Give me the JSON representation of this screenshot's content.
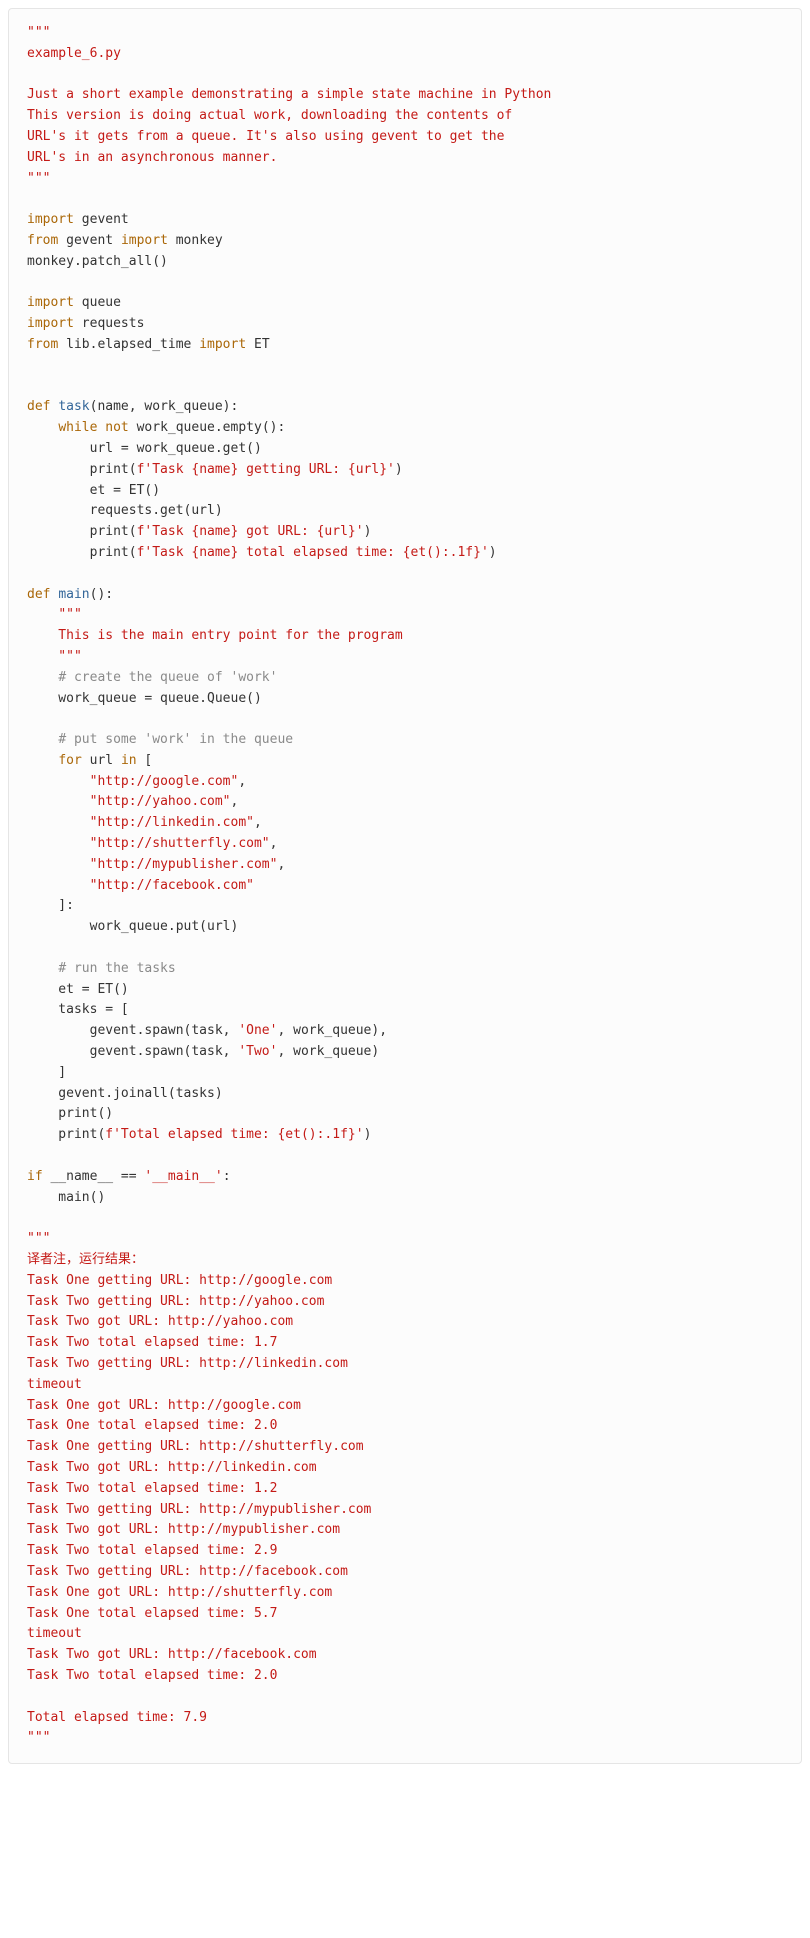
{
  "code": {
    "lines": [
      [
        {
          "cls": "s",
          "t": "\"\"\""
        }
      ],
      [
        {
          "cls": "s",
          "t": "example_6.py"
        }
      ],
      [],
      [
        {
          "cls": "s",
          "t": "Just a short example demonstrating a simple state machine in Python"
        }
      ],
      [
        {
          "cls": "s",
          "t": "This version is doing actual work, downloading the contents of"
        }
      ],
      [
        {
          "cls": "s",
          "t": "URL's it gets from a queue. It's also using gevent to get the"
        }
      ],
      [
        {
          "cls": "s",
          "t": "URL's in an asynchronous manner."
        }
      ],
      [
        {
          "cls": "s",
          "t": "\"\"\""
        }
      ],
      [],
      [
        {
          "cls": "k",
          "t": "import"
        },
        {
          "cls": "n",
          "t": " gevent"
        }
      ],
      [
        {
          "cls": "k",
          "t": "from"
        },
        {
          "cls": "n",
          "t": " gevent "
        },
        {
          "cls": "k",
          "t": "import"
        },
        {
          "cls": "n",
          "t": " monkey"
        }
      ],
      [
        {
          "cls": "n",
          "t": "monkey.patch_all()"
        }
      ],
      [],
      [
        {
          "cls": "k",
          "t": "import"
        },
        {
          "cls": "n",
          "t": " queue"
        }
      ],
      [
        {
          "cls": "k",
          "t": "import"
        },
        {
          "cls": "n",
          "t": " requests"
        }
      ],
      [
        {
          "cls": "k",
          "t": "from"
        },
        {
          "cls": "n",
          "t": " lib.elapsed_time "
        },
        {
          "cls": "k",
          "t": "import"
        },
        {
          "cls": "n",
          "t": " ET"
        }
      ],
      [],
      [],
      [
        {
          "cls": "k",
          "t": "def"
        },
        {
          "cls": "n",
          "t": " "
        },
        {
          "cls": "nf",
          "t": "task"
        },
        {
          "cls": "n",
          "t": "(name, work_queue):"
        }
      ],
      [
        {
          "cls": "n",
          "t": "    "
        },
        {
          "cls": "k",
          "t": "while"
        },
        {
          "cls": "n",
          "t": " "
        },
        {
          "cls": "k",
          "t": "not"
        },
        {
          "cls": "n",
          "t": " work_queue.empty():"
        }
      ],
      [
        {
          "cls": "n",
          "t": "        url = work_queue.get()"
        }
      ],
      [
        {
          "cls": "n",
          "t": "        print("
        },
        {
          "cls": "s",
          "t": "f'Task {name} getting URL: {url}'"
        },
        {
          "cls": "n",
          "t": ")"
        }
      ],
      [
        {
          "cls": "n",
          "t": "        et = ET()"
        }
      ],
      [
        {
          "cls": "n",
          "t": "        requests.get(url)"
        }
      ],
      [
        {
          "cls": "n",
          "t": "        print("
        },
        {
          "cls": "s",
          "t": "f'Task {name} got URL: {url}'"
        },
        {
          "cls": "n",
          "t": ")"
        }
      ],
      [
        {
          "cls": "n",
          "t": "        print("
        },
        {
          "cls": "s",
          "t": "f'Task {name} total elapsed time: {et():.1f}'"
        },
        {
          "cls": "n",
          "t": ")"
        }
      ],
      [],
      [
        {
          "cls": "k",
          "t": "def"
        },
        {
          "cls": "n",
          "t": " "
        },
        {
          "cls": "nf",
          "t": "main"
        },
        {
          "cls": "n",
          "t": "():"
        }
      ],
      [
        {
          "cls": "n",
          "t": "    "
        },
        {
          "cls": "s",
          "t": "\"\"\""
        }
      ],
      [
        {
          "cls": "s",
          "t": "    This is the main entry point for the program"
        }
      ],
      [
        {
          "cls": "s",
          "t": "    \"\"\""
        }
      ],
      [
        {
          "cls": "n",
          "t": "    "
        },
        {
          "cls": "c",
          "t": "# create the queue of 'work'"
        }
      ],
      [
        {
          "cls": "n",
          "t": "    work_queue = queue.Queue()"
        }
      ],
      [],
      [
        {
          "cls": "n",
          "t": "    "
        },
        {
          "cls": "c",
          "t": "# put some 'work' in the queue"
        }
      ],
      [
        {
          "cls": "n",
          "t": "    "
        },
        {
          "cls": "k",
          "t": "for"
        },
        {
          "cls": "n",
          "t": " url "
        },
        {
          "cls": "k",
          "t": "in"
        },
        {
          "cls": "n",
          "t": " ["
        }
      ],
      [
        {
          "cls": "n",
          "t": "        "
        },
        {
          "cls": "s",
          "t": "\"http://google.com\""
        },
        {
          "cls": "n",
          "t": ","
        }
      ],
      [
        {
          "cls": "n",
          "t": "        "
        },
        {
          "cls": "s",
          "t": "\"http://yahoo.com\""
        },
        {
          "cls": "n",
          "t": ","
        }
      ],
      [
        {
          "cls": "n",
          "t": "        "
        },
        {
          "cls": "s",
          "t": "\"http://linkedin.com\""
        },
        {
          "cls": "n",
          "t": ","
        }
      ],
      [
        {
          "cls": "n",
          "t": "        "
        },
        {
          "cls": "s",
          "t": "\"http://shutterfly.com\""
        },
        {
          "cls": "n",
          "t": ","
        }
      ],
      [
        {
          "cls": "n",
          "t": "        "
        },
        {
          "cls": "s",
          "t": "\"http://mypublisher.com\""
        },
        {
          "cls": "n",
          "t": ","
        }
      ],
      [
        {
          "cls": "n",
          "t": "        "
        },
        {
          "cls": "s",
          "t": "\"http://facebook.com\""
        }
      ],
      [
        {
          "cls": "n",
          "t": "    ]:"
        }
      ],
      [
        {
          "cls": "n",
          "t": "        work_queue.put(url)"
        }
      ],
      [],
      [
        {
          "cls": "n",
          "t": "    "
        },
        {
          "cls": "c",
          "t": "# run the tasks"
        }
      ],
      [
        {
          "cls": "n",
          "t": "    et = ET()"
        }
      ],
      [
        {
          "cls": "n",
          "t": "    tasks = ["
        }
      ],
      [
        {
          "cls": "n",
          "t": "        gevent.spawn(task, "
        },
        {
          "cls": "s",
          "t": "'One'"
        },
        {
          "cls": "n",
          "t": ", work_queue),"
        }
      ],
      [
        {
          "cls": "n",
          "t": "        gevent.spawn(task, "
        },
        {
          "cls": "s",
          "t": "'Two'"
        },
        {
          "cls": "n",
          "t": ", work_queue)"
        }
      ],
      [
        {
          "cls": "n",
          "t": "    ]"
        }
      ],
      [
        {
          "cls": "n",
          "t": "    gevent.joinall(tasks)"
        }
      ],
      [
        {
          "cls": "n",
          "t": "    print()"
        }
      ],
      [
        {
          "cls": "n",
          "t": "    print("
        },
        {
          "cls": "s",
          "t": "f'Total elapsed time: {et():.1f}'"
        },
        {
          "cls": "n",
          "t": ")"
        }
      ],
      [],
      [
        {
          "cls": "k",
          "t": "if"
        },
        {
          "cls": "n",
          "t": " __name__ == "
        },
        {
          "cls": "s",
          "t": "'__main__'"
        },
        {
          "cls": "n",
          "t": ":"
        }
      ],
      [
        {
          "cls": "n",
          "t": "    main()"
        }
      ],
      [],
      [
        {
          "cls": "s",
          "t": "\"\"\""
        }
      ],
      [
        {
          "cls": "s",
          "t": "译者注，运行结果："
        }
      ],
      [
        {
          "cls": "s",
          "t": "Task One getting URL: http://google.com"
        }
      ],
      [
        {
          "cls": "s",
          "t": "Task Two getting URL: http://yahoo.com"
        }
      ],
      [
        {
          "cls": "s",
          "t": "Task Two got URL: http://yahoo.com"
        }
      ],
      [
        {
          "cls": "s",
          "t": "Task Two total elapsed time: 1.7"
        }
      ],
      [
        {
          "cls": "s",
          "t": "Task Two getting URL: http://linkedin.com"
        }
      ],
      [
        {
          "cls": "s",
          "t": "timeout"
        }
      ],
      [
        {
          "cls": "s",
          "t": "Task One got URL: http://google.com"
        }
      ],
      [
        {
          "cls": "s",
          "t": "Task One total elapsed time: 2.0"
        }
      ],
      [
        {
          "cls": "s",
          "t": "Task One getting URL: http://shutterfly.com"
        }
      ],
      [
        {
          "cls": "s",
          "t": "Task Two got URL: http://linkedin.com"
        }
      ],
      [
        {
          "cls": "s",
          "t": "Task Two total elapsed time: 1.2"
        }
      ],
      [
        {
          "cls": "s",
          "t": "Task Two getting URL: http://mypublisher.com"
        }
      ],
      [
        {
          "cls": "s",
          "t": "Task Two got URL: http://mypublisher.com"
        }
      ],
      [
        {
          "cls": "s",
          "t": "Task Two total elapsed time: 2.9"
        }
      ],
      [
        {
          "cls": "s",
          "t": "Task Two getting URL: http://facebook.com"
        }
      ],
      [
        {
          "cls": "s",
          "t": "Task One got URL: http://shutterfly.com"
        }
      ],
      [
        {
          "cls": "s",
          "t": "Task One total elapsed time: 5.7"
        }
      ],
      [
        {
          "cls": "s",
          "t": "timeout"
        }
      ],
      [
        {
          "cls": "s",
          "t": "Task Two got URL: http://facebook.com"
        }
      ],
      [
        {
          "cls": "s",
          "t": "Task Two total elapsed time: 2.0"
        }
      ],
      [],
      [
        {
          "cls": "s",
          "t": "Total elapsed time: 7.9"
        }
      ],
      [
        {
          "cls": "s",
          "t": "\"\"\""
        }
      ]
    ]
  }
}
